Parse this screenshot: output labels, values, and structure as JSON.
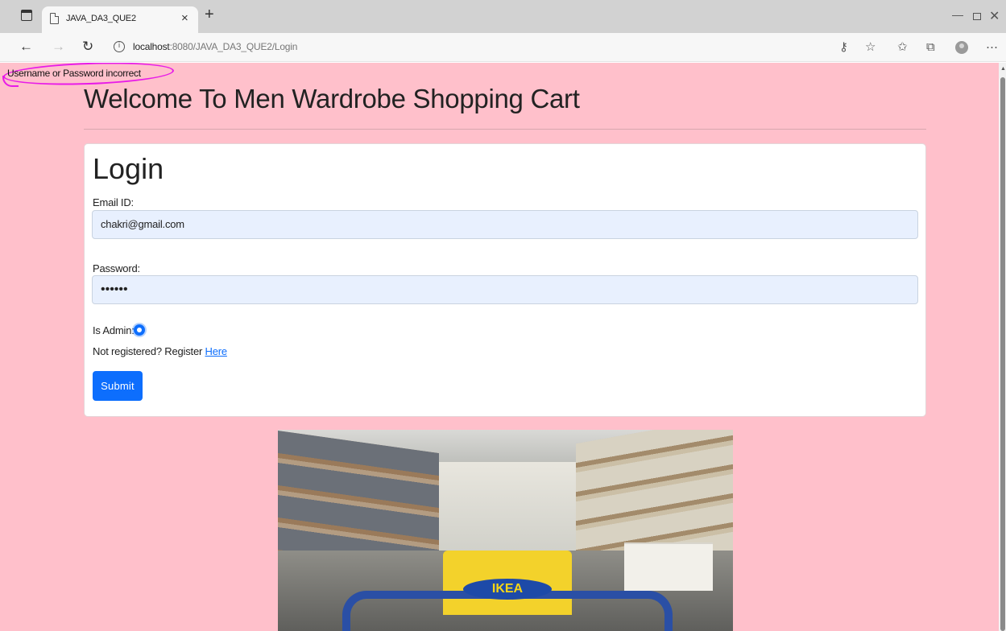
{
  "browser": {
    "tab_title": "JAVA_DA3_QUE2",
    "tab_close_glyph": "×",
    "new_tab_glyph": "+",
    "url_host": "localhost",
    "url_path": ":8080/JAVA_DA3_QUE2/Login",
    "icons": [
      "tab-actions-icon",
      "page-icon",
      "back-arrow-icon",
      "forward-arrow-icon",
      "reload-icon",
      "site-info-icon",
      "password-key-icon",
      "add-favorite-icon",
      "favorites-icon",
      "collections-icon",
      "profile-avatar",
      "more-menu-icon",
      "minimize-icon",
      "maximize-icon",
      "close-icon"
    ]
  },
  "page": {
    "error_message": "Username or Password incorrect",
    "heading": "Welcome To Men Wardrobe Shopping Cart",
    "colors": {
      "background": "#ffc0cb",
      "primary": "#0d6efd",
      "annotation": "#e81be8"
    }
  },
  "login": {
    "title": "Login",
    "email_label": "Email ID:",
    "email_value": "chakri@gmail.com",
    "password_label": "Password:",
    "password_value": "••••••",
    "admin_label": "Is Admin:",
    "admin_checked": true,
    "register_text": "Not registered? Register ",
    "register_link": "Here",
    "submit_label": "Submit"
  },
  "image": {
    "logo_text": "IKEA"
  }
}
